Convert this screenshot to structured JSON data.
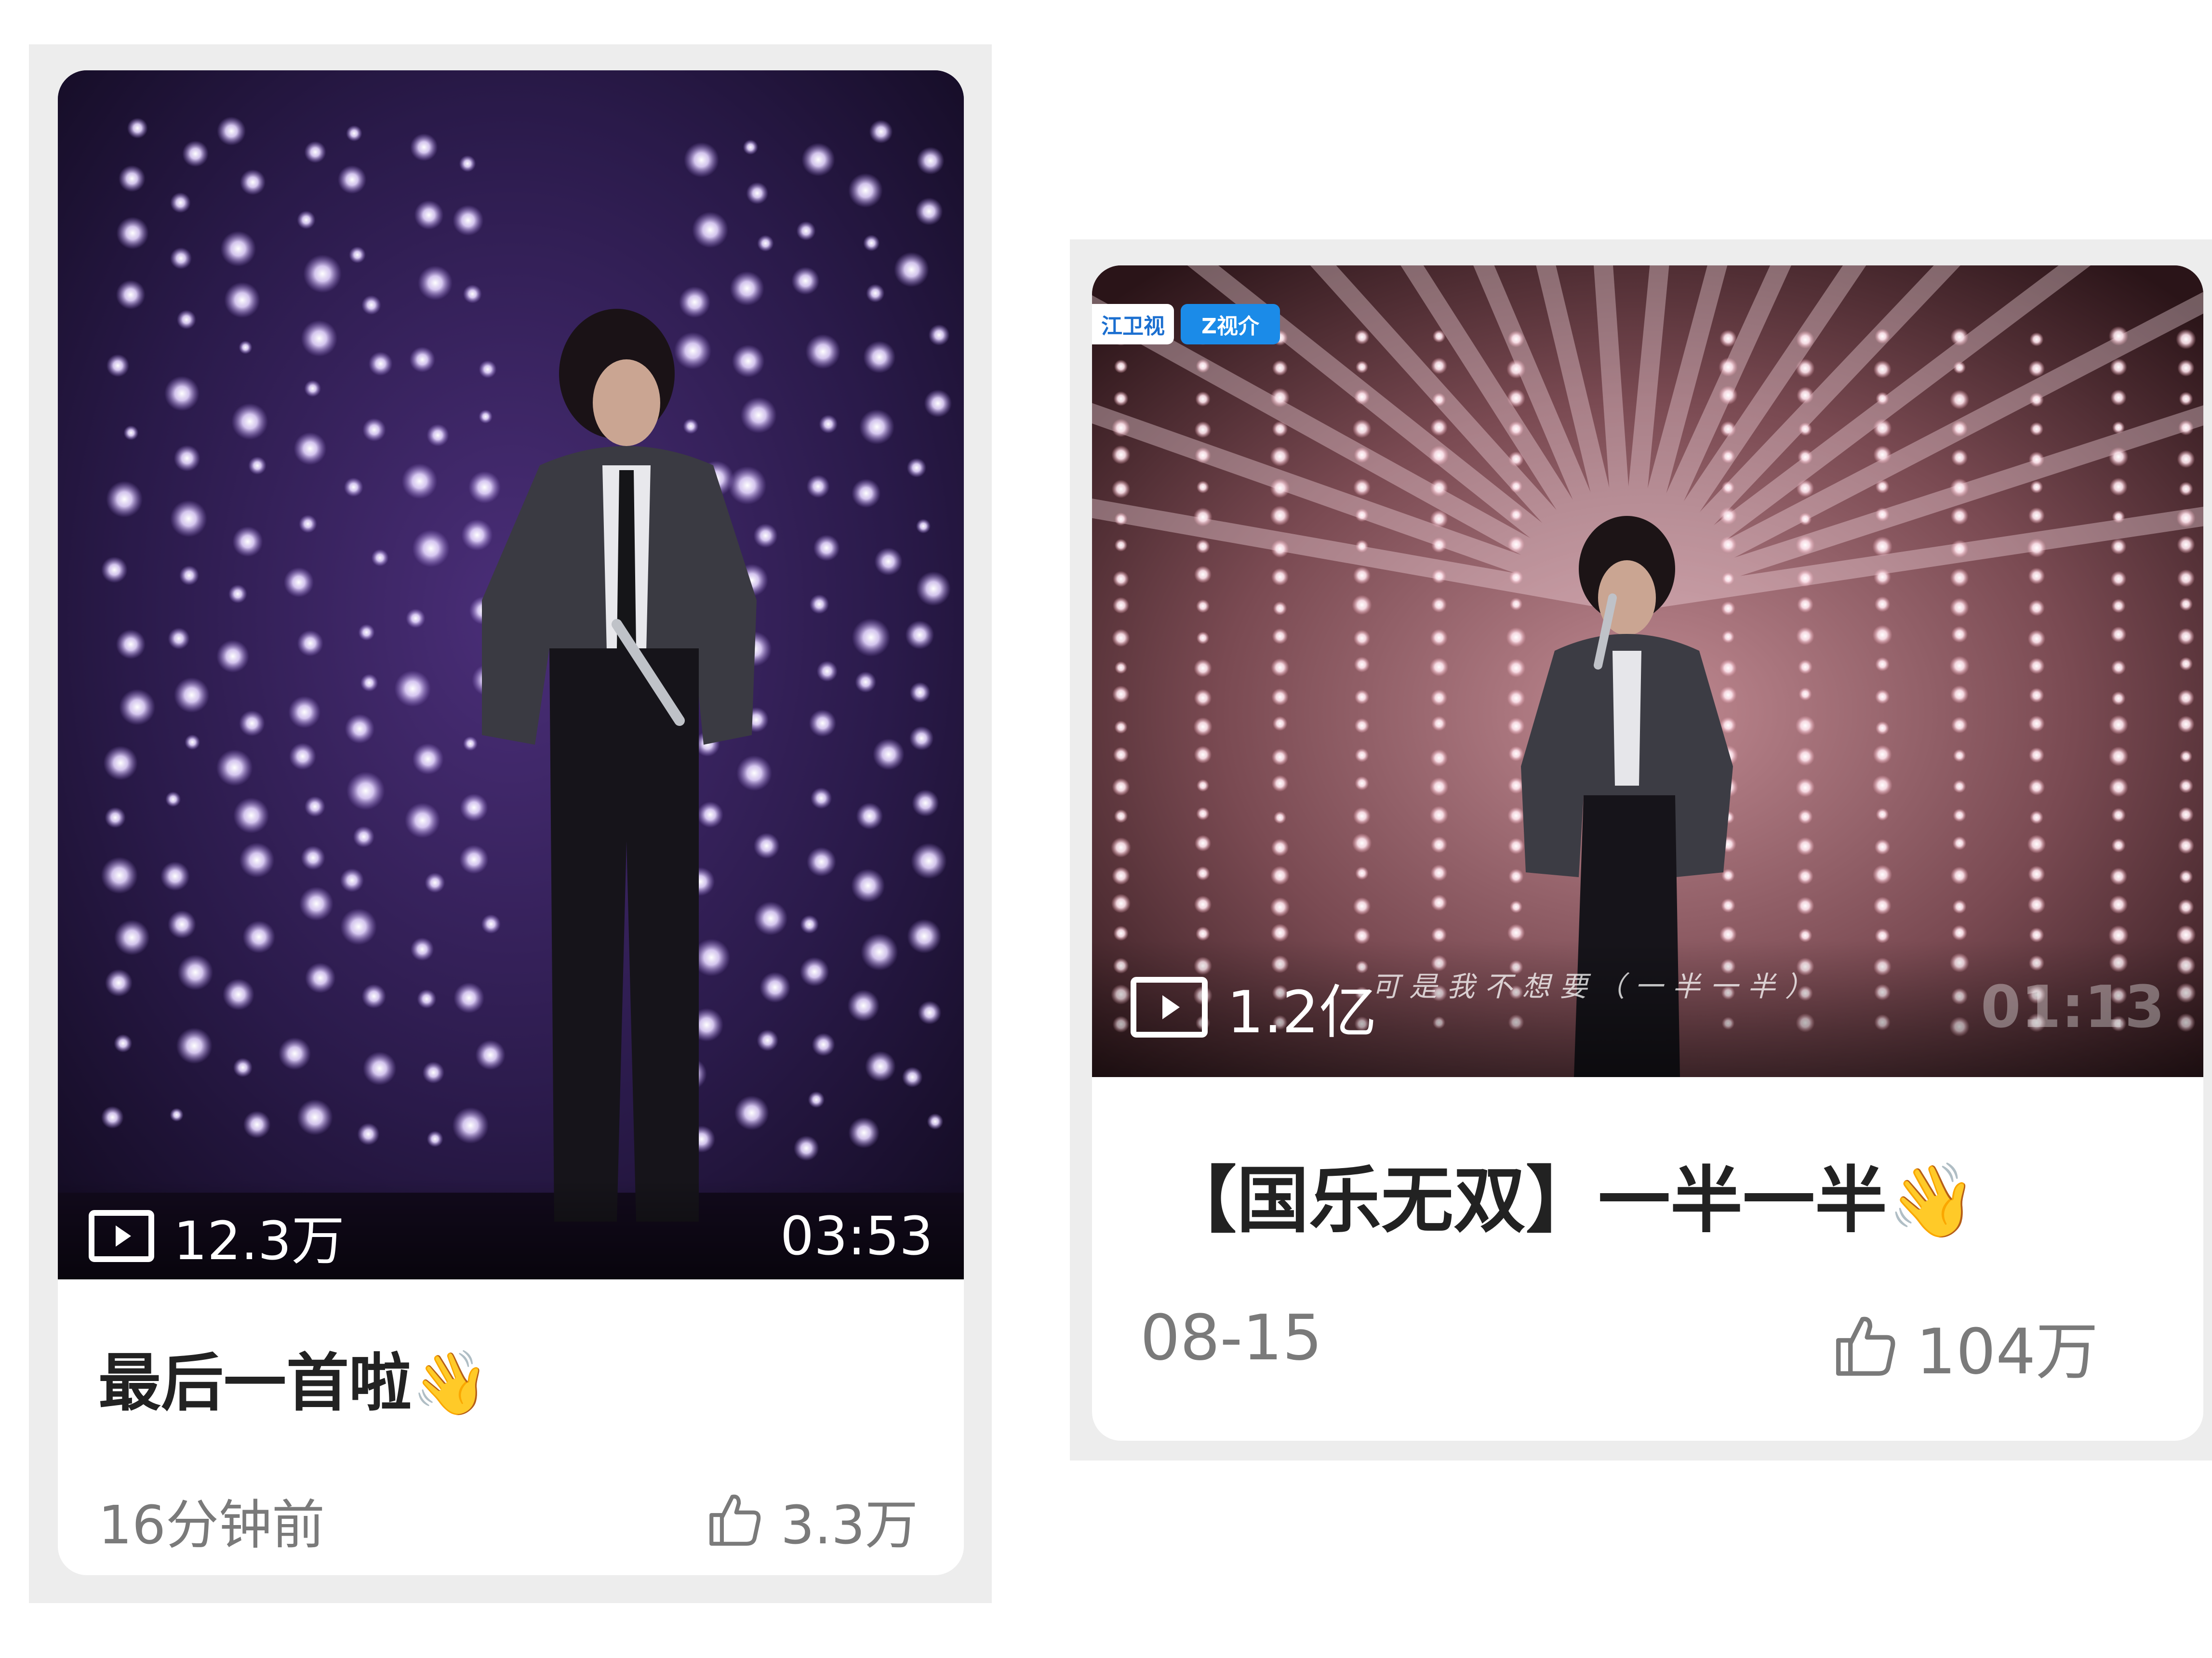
{
  "cards": [
    {
      "view_count": "12.3万",
      "duration": "03:53",
      "title": "最后一首啦👋",
      "time": "16分钟前",
      "likes": "3.3万",
      "icons": {
        "play": "play-icon",
        "like": "thumbs-up-icon"
      },
      "theme": {
        "background": "#2a1840",
        "light": "#f2eaff"
      }
    },
    {
      "view_count": "1.2亿",
      "duration": "01:13",
      "title": "【国乐无双】一半一半👋",
      "time": "08-15",
      "likes": "104万",
      "badges": [
        "江卫视",
        "Z视介"
      ],
      "lyric": "可是我不想要（一半一半）",
      "icons": {
        "play": "play-icon",
        "like": "thumbs-up-icon"
      },
      "theme": {
        "background": "#3a2228",
        "light": "#ffe9f0",
        "badge_text": "#1b8be8"
      }
    }
  ]
}
